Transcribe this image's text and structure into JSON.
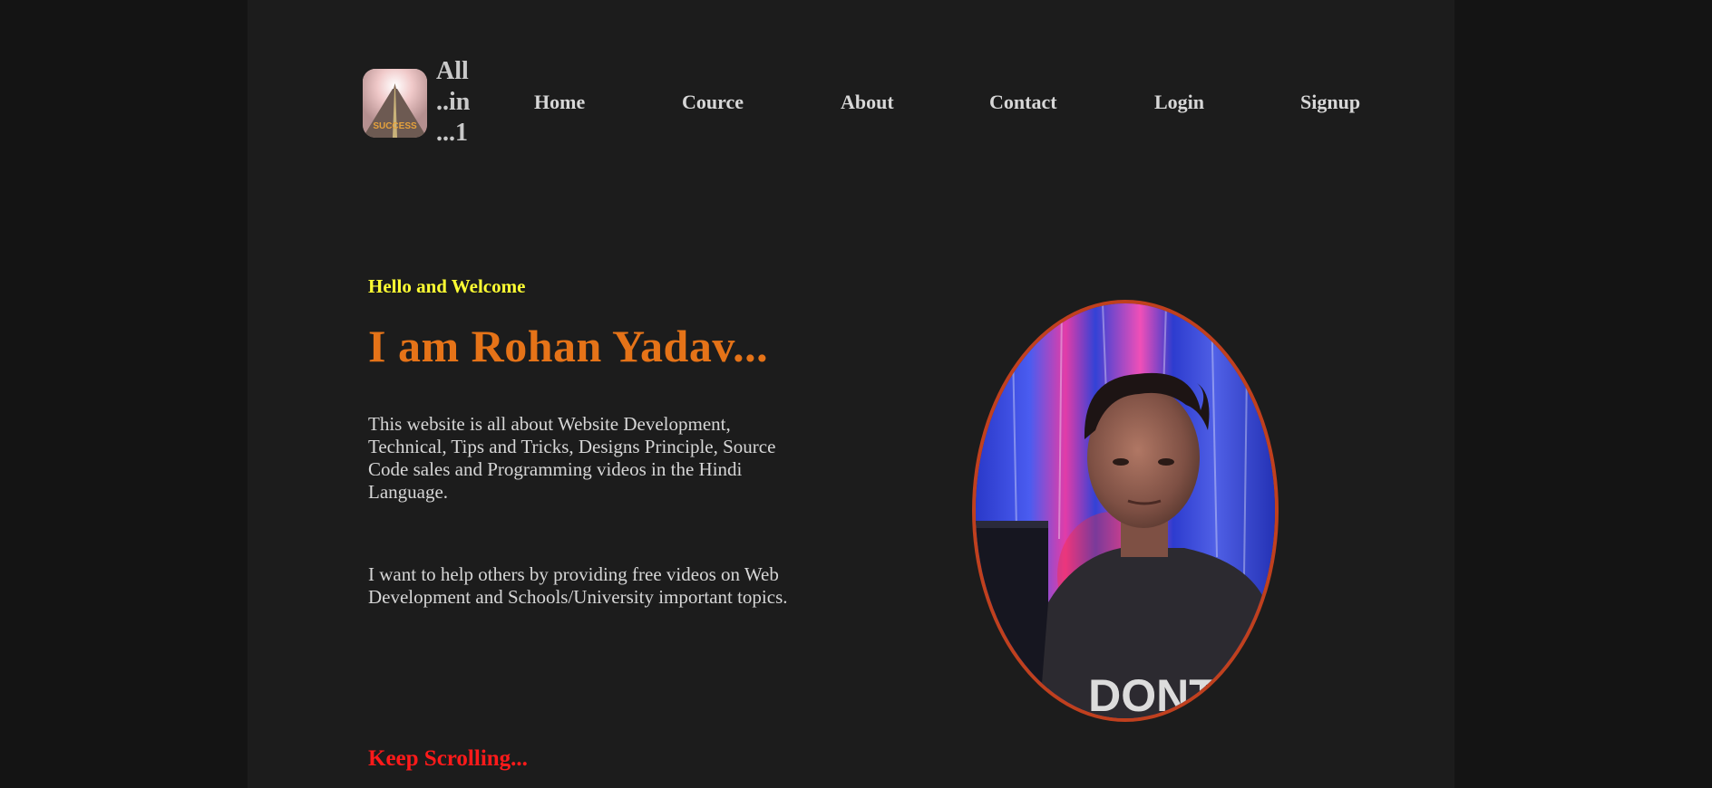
{
  "header": {
    "logo_badge_text": "SUCCESS",
    "logo_text_lines": [
      "All",
      "..in",
      "...1"
    ]
  },
  "nav": {
    "items": [
      {
        "label": "Home"
      },
      {
        "label": "Cource"
      },
      {
        "label": "About"
      },
      {
        "label": "Contact"
      },
      {
        "label": "Login"
      },
      {
        "label": "Signup"
      }
    ]
  },
  "hero": {
    "greeting": "Hello and Welcome",
    "title": "I am Rohan Yadav...",
    "paragraph_1": "This website is all about Website Development, Technical, Tips and Tricks, Designs Principle, Source Code sales and Programming videos in the Hindi Language.",
    "paragraph_2": "I want to help others by providing free videos on Web Development and Schools/University important topics.",
    "scroll_hint": "Keep Scrolling...",
    "portrait_shirt_text": "DONT"
  },
  "colors": {
    "page_bg": "#141414",
    "content_bg": "#1c1c1c",
    "greeting": "#ffff33",
    "title": "#e57318",
    "scroll_hint": "#ff1a1a",
    "portrait_border": "#c0401e",
    "nav_text": "#d7d7d7"
  }
}
